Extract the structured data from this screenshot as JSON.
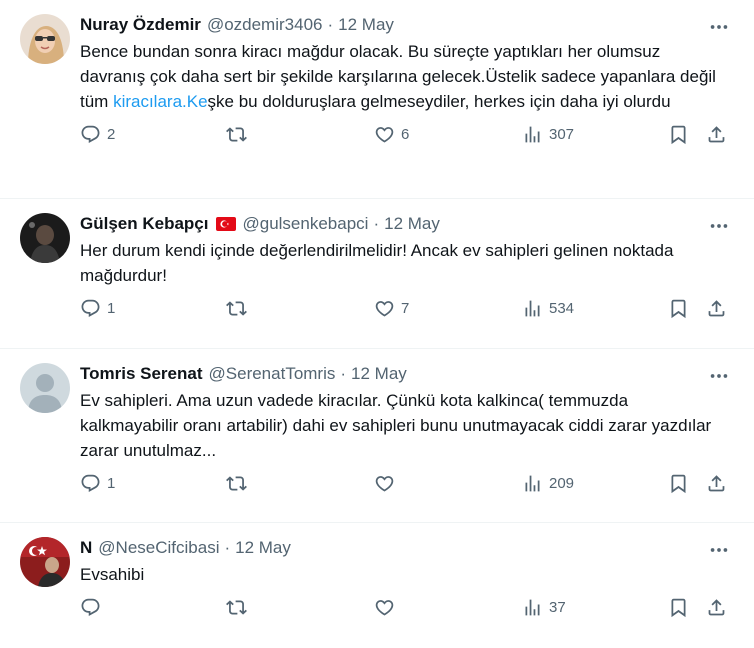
{
  "tweets": [
    {
      "name": "Nuray Özdemir",
      "handle": "@ozdemir3406",
      "dot": "·",
      "date": "12 May",
      "text_before": "Bence bundan sonra kiracı mağdur olacak. Bu süreçte yaptıkları her olumsuz davranış çok daha sert bir şekilde karşılarına gelecek.Üstelik sadece yapanlara değil tüm ",
      "link": "kiracılara.Ke",
      "text_after": "şke bu dolduruşlara gelmeseydiler, herkes için daha iyi olurdu",
      "replies": "2",
      "retweets": "",
      "likes": "6",
      "views": "307"
    },
    {
      "name": "Gülşen Kebapçı",
      "flag_icon": "turkey-flag-icon",
      "handle": "@gulsenkebapci",
      "dot": "·",
      "date": "12 May",
      "text": "Her durum kendi içinde değerlendirilmelidir! Ancak ev sahipleri gelinen noktada mağdurdur!",
      "replies": "1",
      "retweets": "",
      "likes": "7",
      "views": "534"
    },
    {
      "name": "Tomris Serenat",
      "handle": "@SerenatTomris",
      "dot": "·",
      "date": "12 May",
      "text": "Ev sahipleri. Ama uzun vadede kiracılar. Çünkü kota kalkinca( temmuzda kalkmayabilir oranı artabilir) dahi ev sahipleri bunu unutmayacak ciddi zarar yazdılar zarar unutulmaz...",
      "replies": "1",
      "retweets": "",
      "likes": "",
      "views": "209"
    },
    {
      "name": "N",
      "handle": "@NeseCifcibasi",
      "dot": "·",
      "date": "12 May",
      "text": "Evsahibi",
      "replies": "",
      "retweets": "",
      "likes": "",
      "views": "37"
    }
  ],
  "colors": {
    "text": "#0f1419",
    "secondary": "#536471",
    "link": "#1d9bf0",
    "divider": "#eff3f4"
  }
}
